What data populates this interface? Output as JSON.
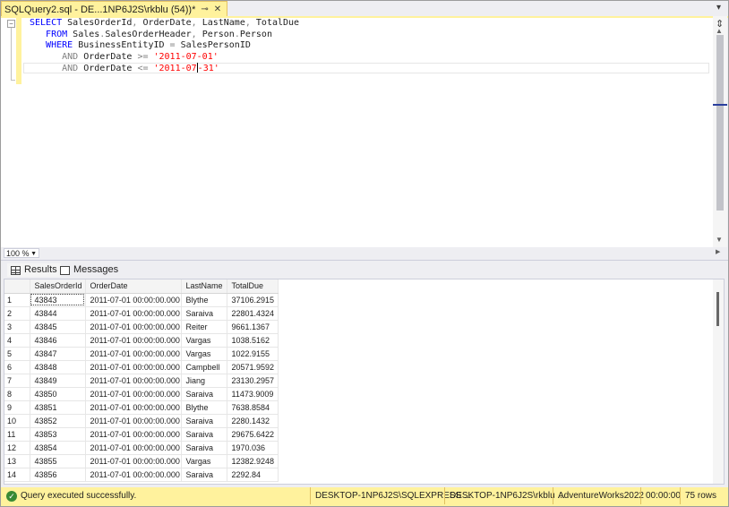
{
  "tab": {
    "title": "SQLQuery2.sql - DE...1NP6J2S\\rkblu (54))*",
    "pin_glyph": "⊸",
    "close_glyph": "✕"
  },
  "editor": {
    "lines": [
      [
        {
          "t": "SELECT ",
          "c": "kw"
        },
        {
          "t": "SalesOrderId",
          "c": "tx"
        },
        {
          "t": ", ",
          "c": "gr"
        },
        {
          "t": "OrderDate",
          "c": "tx"
        },
        {
          "t": ", ",
          "c": "gr"
        },
        {
          "t": "LastName",
          "c": "tx"
        },
        {
          "t": ", ",
          "c": "gr"
        },
        {
          "t": "TotalDue",
          "c": "tx"
        }
      ],
      [
        {
          "t": "   FROM ",
          "c": "kw"
        },
        {
          "t": "Sales",
          "c": "tx"
        },
        {
          "t": ".",
          "c": "gr"
        },
        {
          "t": "SalesOrderHeader",
          "c": "tx"
        },
        {
          "t": ", ",
          "c": "gr"
        },
        {
          "t": "Person",
          "c": "tx"
        },
        {
          "t": ".",
          "c": "gr"
        },
        {
          "t": "Person",
          "c": "tx"
        }
      ],
      [
        {
          "t": "   WHERE ",
          "c": "kw"
        },
        {
          "t": "BusinessEntityID ",
          "c": "tx"
        },
        {
          "t": "= ",
          "c": "gr"
        },
        {
          "t": "SalesPersonID",
          "c": "tx"
        }
      ],
      [
        {
          "t": "      AND ",
          "c": "gr"
        },
        {
          "t": "OrderDate ",
          "c": "tx"
        },
        {
          "t": ">= ",
          "c": "gr"
        },
        {
          "t": "'2011-07-01'",
          "c": "str"
        }
      ],
      [
        {
          "t": "      AND ",
          "c": "gr"
        },
        {
          "t": "OrderDate ",
          "c": "tx"
        },
        {
          "t": "<= ",
          "c": "gr"
        },
        {
          "t": "'2011-07",
          "c": "str"
        },
        {
          "t": "|caret|",
          "c": "caret"
        },
        {
          "t": "-31'",
          "c": "str"
        }
      ]
    ]
  },
  "zoom": {
    "value": "100 %"
  },
  "result_tabs": {
    "results": "Results",
    "messages": "Messages"
  },
  "grid": {
    "columns": [
      "SalesOrderId",
      "OrderDate",
      "LastName",
      "TotalDue"
    ],
    "rows": [
      [
        "1",
        "43843",
        "2011-07-01 00:00:00.000",
        "Blythe",
        "37106.2915"
      ],
      [
        "2",
        "43844",
        "2011-07-01 00:00:00.000",
        "Saraiva",
        "22801.4324"
      ],
      [
        "3",
        "43845",
        "2011-07-01 00:00:00.000",
        "Reiter",
        "9661.1367"
      ],
      [
        "4",
        "43846",
        "2011-07-01 00:00:00.000",
        "Vargas",
        "1038.5162"
      ],
      [
        "5",
        "43847",
        "2011-07-01 00:00:00.000",
        "Vargas",
        "1022.9155"
      ],
      [
        "6",
        "43848",
        "2011-07-01 00:00:00.000",
        "Campbell",
        "20571.9592"
      ],
      [
        "7",
        "43849",
        "2011-07-01 00:00:00.000",
        "Jiang",
        "23130.2957"
      ],
      [
        "8",
        "43850",
        "2011-07-01 00:00:00.000",
        "Saraiva",
        "11473.9009"
      ],
      [
        "9",
        "43851",
        "2011-07-01 00:00:00.000",
        "Blythe",
        "7638.8584"
      ],
      [
        "10",
        "43852",
        "2011-07-01 00:00:00.000",
        "Saraiva",
        "2280.1432"
      ],
      [
        "11",
        "43853",
        "2011-07-01 00:00:00.000",
        "Saraiva",
        "29675.6422"
      ],
      [
        "12",
        "43854",
        "2011-07-01 00:00:00.000",
        "Saraiva",
        "1970.036"
      ],
      [
        "13",
        "43855",
        "2011-07-01 00:00:00.000",
        "Vargas",
        "12382.9248"
      ],
      [
        "14",
        "43856",
        "2011-07-01 00:00:00.000",
        "Saraiva",
        "2292.84"
      ]
    ]
  },
  "status": {
    "message": "Query executed successfully.",
    "server": "DESKTOP-1NP6J2S\\SQLEXPRESS ...",
    "user": "DESKTOP-1NP6J2S\\rkblu ...",
    "database": "AdventureWorks2022",
    "elapsed": "00:00:00",
    "rows": "75 rows"
  },
  "colors": {
    "accent_yellow": "#fff29d",
    "keyword": "#0000ff",
    "string": "#ff0000",
    "operator": "#808080",
    "success": "#388a34"
  }
}
